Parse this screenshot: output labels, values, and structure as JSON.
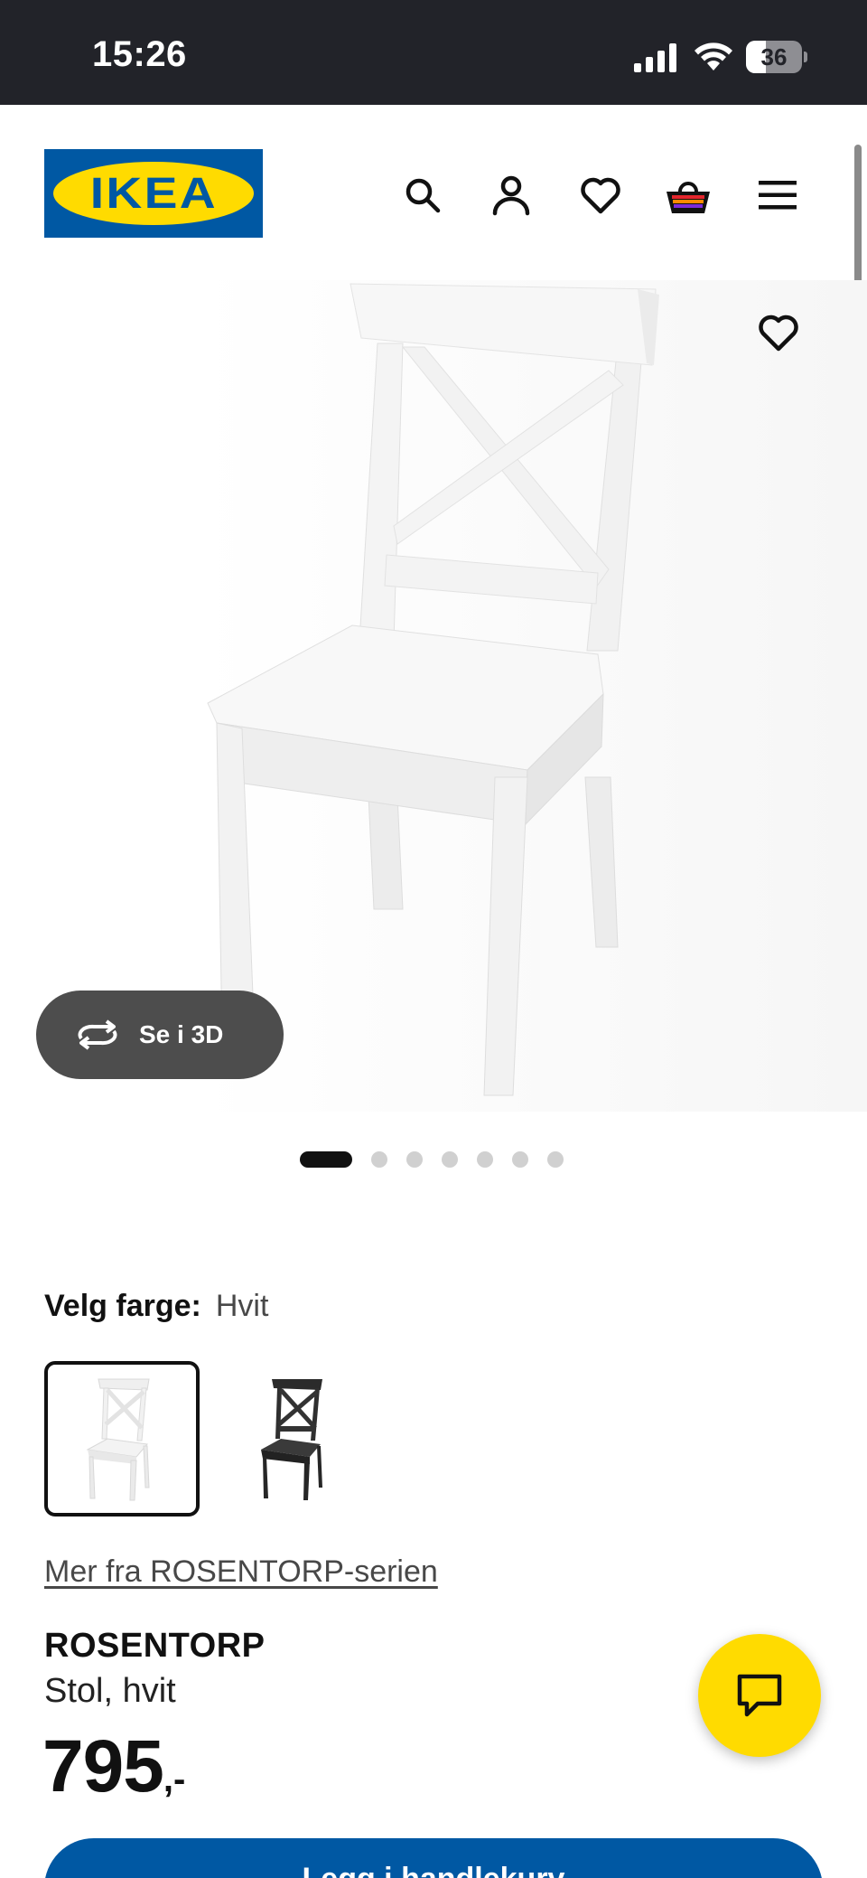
{
  "status_bar": {
    "time": "15:26",
    "battery_text": "36",
    "battery_level": 0.36,
    "icons": [
      "cellular-signal-icon",
      "wifi-icon",
      "battery-icon"
    ]
  },
  "header": {
    "logo_text": "IKEA",
    "icons": [
      "search-icon",
      "account-icon",
      "heart-icon",
      "shopping-bag-icon",
      "menu-icon"
    ]
  },
  "gallery": {
    "view_3d_label": "Se i 3D",
    "image_count": 7,
    "active_index": 0
  },
  "color_selector": {
    "label": "Velg farge:",
    "selected_value": "Hvit",
    "options": [
      "white-chair-swatch",
      "black-chair-swatch"
    ]
  },
  "series_link": "Mer fra ROSENTORP-serien",
  "product": {
    "name": "ROSENTORP",
    "description": "Stol, hvit",
    "price_main": "795",
    "price_suffix": ",-"
  },
  "cart_button_label": "Legg i handlekurv",
  "colors": {
    "ikea_blue": "#0058a3",
    "ikea_yellow": "#ffdb00",
    "status_bar": "#222329",
    "button_3d": "#4d4d4d"
  }
}
